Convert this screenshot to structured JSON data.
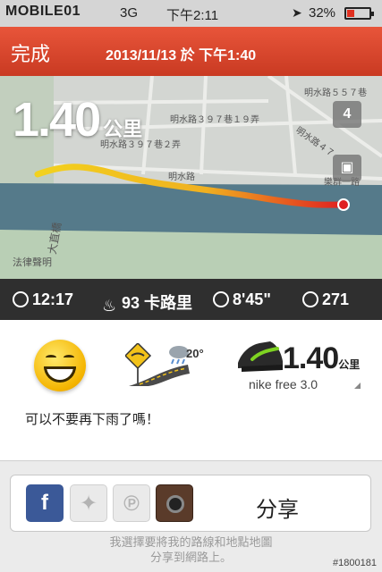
{
  "status_bar": {
    "carrier_logo": "MOBILE01",
    "network": "3G",
    "time": "下午2:11",
    "battery_pct": "32%",
    "battery_level": 0.32
  },
  "header": {
    "done_label": "完成",
    "title": "2013/11/13 於 下午1:40"
  },
  "map": {
    "distance": "1.40",
    "distance_unit": "公里",
    "route_color_start": "#f2d21e",
    "route_color_end": "#e02020",
    "street_labels": [
      "明水路５５７巷",
      "明水路３９７巷１９弄",
      "明水路３９７巷２弄",
      "明水路",
      "明水路４７",
      "樂群一路",
      "大直橋"
    ],
    "map_btn_label": "4",
    "legal_label": "法律聲明"
  },
  "stats": {
    "duration": "12:17",
    "calories": "93 卡路里",
    "pace": "8'45\"",
    "fuel": "271"
  },
  "card": {
    "temperature": "20°",
    "shoe_distance": "1.40",
    "shoe_unit": "公里",
    "shoe_name": "nike free 3.0",
    "note": "可以不要再下雨了嗎！"
  },
  "share": {
    "label": "分享",
    "footer_line1": "我選擇要將我的路線和地點地圖",
    "footer_line2": "分享到網路上。"
  },
  "watermark": "#1800181"
}
